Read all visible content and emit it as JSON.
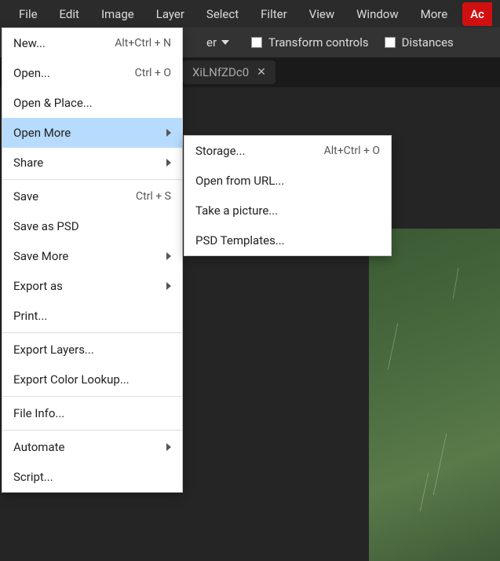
{
  "menubar": {
    "items": [
      "File",
      "Edit",
      "Image",
      "Layer",
      "Select",
      "Filter",
      "View",
      "Window",
      "More"
    ],
    "ad": "Ac"
  },
  "options_bar": {
    "dropdown_suffix": "er",
    "transform_label": "Transform controls",
    "distances_label": "Distances"
  },
  "tab": {
    "name": "XiLNfZDc0",
    "close": "✕"
  },
  "file_menu": {
    "groups": [
      [
        {
          "label": "New...",
          "shortcut": "Alt+Ctrl + N"
        },
        {
          "label": "Open...",
          "shortcut": "Ctrl + O"
        },
        {
          "label": "Open & Place..."
        },
        {
          "label": "Open More",
          "submenu": true,
          "highlighted": true
        },
        {
          "label": "Share",
          "submenu": true
        }
      ],
      [
        {
          "label": "Save",
          "shortcut": "Ctrl + S"
        },
        {
          "label": "Save as PSD"
        },
        {
          "label": "Save More",
          "submenu": true
        },
        {
          "label": "Export as",
          "submenu": true
        },
        {
          "label": "Print..."
        }
      ],
      [
        {
          "label": "Export Layers..."
        },
        {
          "label": "Export Color Lookup..."
        }
      ],
      [
        {
          "label": "File Info..."
        }
      ],
      [
        {
          "label": "Automate",
          "submenu": true
        },
        {
          "label": "Script..."
        }
      ]
    ]
  },
  "open_more_submenu": {
    "items": [
      {
        "label": "Storage...",
        "shortcut": "Alt+Ctrl + O"
      },
      {
        "label": "Open from URL..."
      },
      {
        "label": "Take a picture..."
      },
      {
        "label": "PSD Templates..."
      }
    ]
  }
}
